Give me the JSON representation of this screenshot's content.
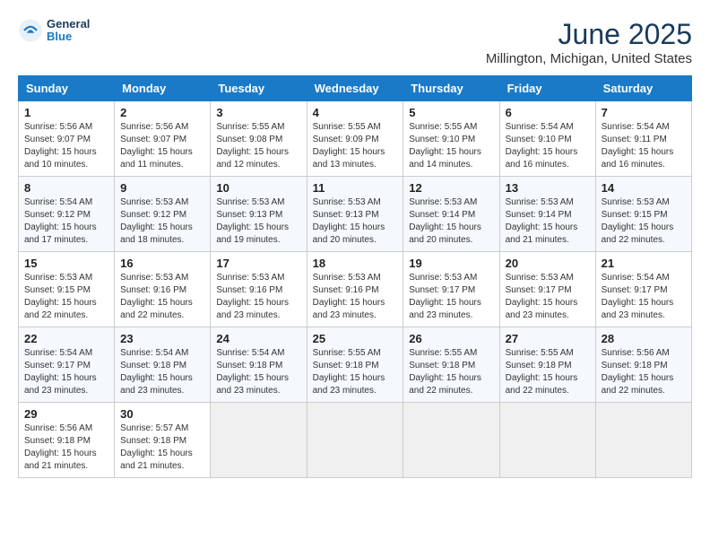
{
  "header": {
    "logo_general": "General",
    "logo_blue": "Blue",
    "main_title": "June 2025",
    "subtitle": "Millington, Michigan, United States"
  },
  "calendar": {
    "days_of_week": [
      "Sunday",
      "Monday",
      "Tuesday",
      "Wednesday",
      "Thursday",
      "Friday",
      "Saturday"
    ],
    "weeks": [
      [
        {
          "day": "",
          "info": ""
        },
        {
          "day": "2",
          "info": "Sunrise: 5:56 AM\nSunset: 9:07 PM\nDaylight: 15 hours and 11 minutes."
        },
        {
          "day": "3",
          "info": "Sunrise: 5:55 AM\nSunset: 9:08 PM\nDaylight: 15 hours and 12 minutes."
        },
        {
          "day": "4",
          "info": "Sunrise: 5:55 AM\nSunset: 9:09 PM\nDaylight: 15 hours and 13 minutes."
        },
        {
          "day": "5",
          "info": "Sunrise: 5:55 AM\nSunset: 9:10 PM\nDaylight: 15 hours and 14 minutes."
        },
        {
          "day": "6",
          "info": "Sunrise: 5:54 AM\nSunset: 9:10 PM\nDaylight: 15 hours and 16 minutes."
        },
        {
          "day": "7",
          "info": "Sunrise: 5:54 AM\nSunset: 9:11 PM\nDaylight: 15 hours and 16 minutes."
        }
      ],
      [
        {
          "day": "1",
          "info": "Sunrise: 5:56 AM\nSunset: 9:07 PM\nDaylight: 15 hours and 10 minutes."
        },
        {
          "day": "9",
          "info": "Sunrise: 5:53 AM\nSunset: 9:12 PM\nDaylight: 15 hours and 18 minutes."
        },
        {
          "day": "10",
          "info": "Sunrise: 5:53 AM\nSunset: 9:13 PM\nDaylight: 15 hours and 19 minutes."
        },
        {
          "day": "11",
          "info": "Sunrise: 5:53 AM\nSunset: 9:13 PM\nDaylight: 15 hours and 20 minutes."
        },
        {
          "day": "12",
          "info": "Sunrise: 5:53 AM\nSunset: 9:14 PM\nDaylight: 15 hours and 20 minutes."
        },
        {
          "day": "13",
          "info": "Sunrise: 5:53 AM\nSunset: 9:14 PM\nDaylight: 15 hours and 21 minutes."
        },
        {
          "day": "14",
          "info": "Sunrise: 5:53 AM\nSunset: 9:15 PM\nDaylight: 15 hours and 22 minutes."
        }
      ],
      [
        {
          "day": "8",
          "info": "Sunrise: 5:54 AM\nSunset: 9:12 PM\nDaylight: 15 hours and 17 minutes."
        },
        {
          "day": "16",
          "info": "Sunrise: 5:53 AM\nSunset: 9:16 PM\nDaylight: 15 hours and 22 minutes."
        },
        {
          "day": "17",
          "info": "Sunrise: 5:53 AM\nSunset: 9:16 PM\nDaylight: 15 hours and 23 minutes."
        },
        {
          "day": "18",
          "info": "Sunrise: 5:53 AM\nSunset: 9:16 PM\nDaylight: 15 hours and 23 minutes."
        },
        {
          "day": "19",
          "info": "Sunrise: 5:53 AM\nSunset: 9:17 PM\nDaylight: 15 hours and 23 minutes."
        },
        {
          "day": "20",
          "info": "Sunrise: 5:53 AM\nSunset: 9:17 PM\nDaylight: 15 hours and 23 minutes."
        },
        {
          "day": "21",
          "info": "Sunrise: 5:54 AM\nSunset: 9:17 PM\nDaylight: 15 hours and 23 minutes."
        }
      ],
      [
        {
          "day": "15",
          "info": "Sunrise: 5:53 AM\nSunset: 9:15 PM\nDaylight: 15 hours and 22 minutes."
        },
        {
          "day": "23",
          "info": "Sunrise: 5:54 AM\nSunset: 9:18 PM\nDaylight: 15 hours and 23 minutes."
        },
        {
          "day": "24",
          "info": "Sunrise: 5:54 AM\nSunset: 9:18 PM\nDaylight: 15 hours and 23 minutes."
        },
        {
          "day": "25",
          "info": "Sunrise: 5:55 AM\nSunset: 9:18 PM\nDaylight: 15 hours and 23 minutes."
        },
        {
          "day": "26",
          "info": "Sunrise: 5:55 AM\nSunset: 9:18 PM\nDaylight: 15 hours and 22 minutes."
        },
        {
          "day": "27",
          "info": "Sunrise: 5:55 AM\nSunset: 9:18 PM\nDaylight: 15 hours and 22 minutes."
        },
        {
          "day": "28",
          "info": "Sunrise: 5:56 AM\nSunset: 9:18 PM\nDaylight: 15 hours and 22 minutes."
        }
      ],
      [
        {
          "day": "22",
          "info": "Sunrise: 5:54 AM\nSunset: 9:17 PM\nDaylight: 15 hours and 23 minutes."
        },
        {
          "day": "30",
          "info": "Sunrise: 5:57 AM\nSunset: 9:18 PM\nDaylight: 15 hours and 21 minutes."
        },
        {
          "day": "",
          "info": ""
        },
        {
          "day": "",
          "info": ""
        },
        {
          "day": "",
          "info": ""
        },
        {
          "day": "",
          "info": ""
        },
        {
          "day": "",
          "info": ""
        }
      ],
      [
        {
          "day": "29",
          "info": "Sunrise: 5:56 AM\nSunset: 9:18 PM\nDaylight: 15 hours and 21 minutes."
        },
        {
          "day": "",
          "info": ""
        },
        {
          "day": "",
          "info": ""
        },
        {
          "day": "",
          "info": ""
        },
        {
          "day": "",
          "info": ""
        },
        {
          "day": "",
          "info": ""
        },
        {
          "day": "",
          "info": ""
        }
      ]
    ]
  }
}
